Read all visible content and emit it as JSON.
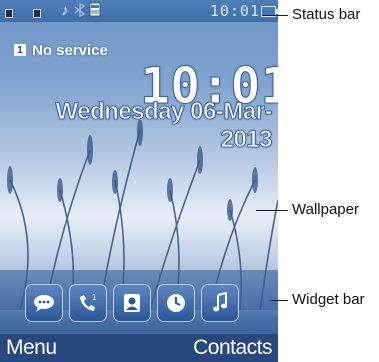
{
  "status_bar": {
    "time": "10:01",
    "sim1_icon": "sim1-signal-icon",
    "sim2_icon": "sim2-signal-icon",
    "icons": [
      "music-note-icon",
      "bluetooth-icon",
      "alarm-icon",
      "battery-icon"
    ]
  },
  "idle": {
    "sim_number": "1",
    "service": "No service",
    "clock_hours": "10",
    "clock_minutes": "01",
    "date": "Wednesday 06-Mar-2013"
  },
  "widgets": [
    {
      "name": "messages-widget",
      "icon": "speech-bubble-icon"
    },
    {
      "name": "call-log-widget",
      "icon": "call-log-icon",
      "badge": "1"
    },
    {
      "name": "contacts-widget",
      "icon": "contact-card-icon"
    },
    {
      "name": "alarm-widget",
      "icon": "clock-icon"
    },
    {
      "name": "music-widget",
      "icon": "music-icon"
    }
  ],
  "softkeys": {
    "left": "Menu",
    "right": "Contacts"
  },
  "callouts": {
    "status_bar": "Status bar",
    "wallpaper": "Wallpaper",
    "widget_bar": "Widget bar"
  },
  "colors": {
    "screen_bg": "#7fa2cf",
    "softkey_bar": "#27477d",
    "widget_bg": "#2d5797"
  }
}
